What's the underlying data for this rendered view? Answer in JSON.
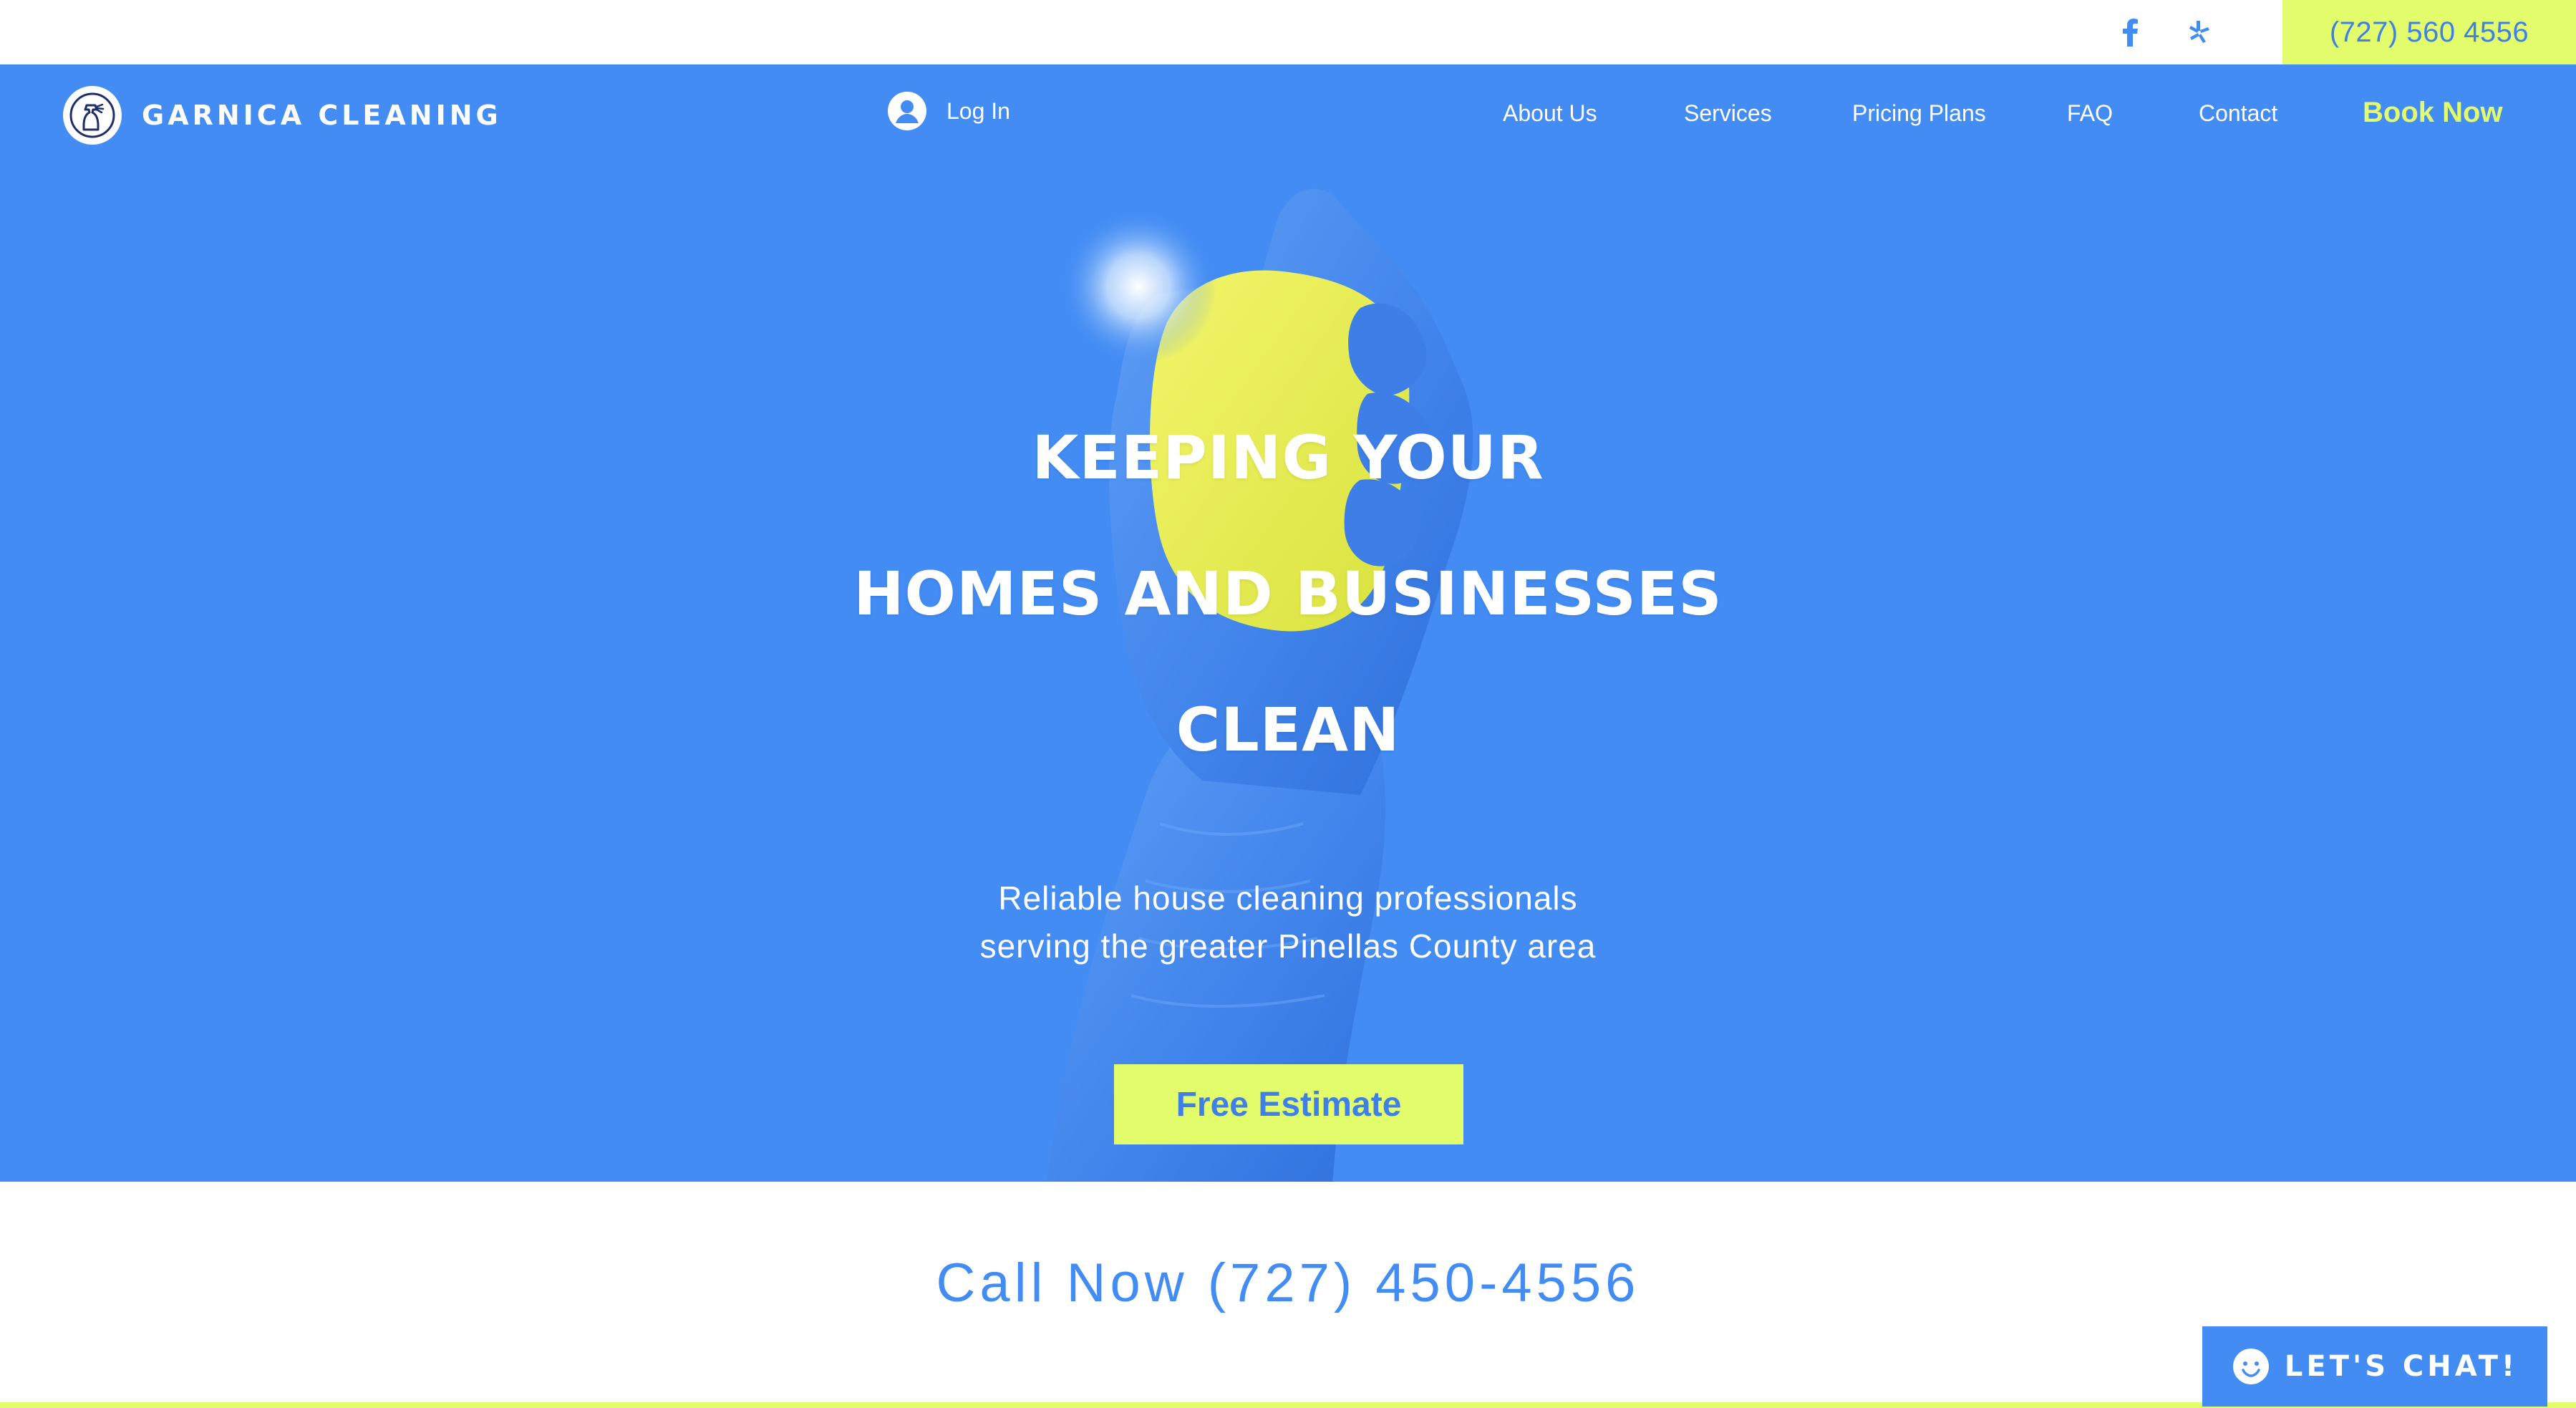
{
  "topbar": {
    "phone": "(727) 560 4556",
    "social": [
      {
        "icon": "facebook-icon"
      },
      {
        "icon": "yelp-icon"
      }
    ]
  },
  "header": {
    "brand": "GARNICA CLEANING",
    "login_label": "Log In",
    "nav": [
      {
        "label": "About Us"
      },
      {
        "label": "Services"
      },
      {
        "label": "Pricing Plans"
      },
      {
        "label": "FAQ"
      },
      {
        "label": "Contact"
      }
    ],
    "book_label": "Book Now"
  },
  "hero": {
    "headline_lines": [
      "KEEPING YOUR",
      "HOMES AND BUSINESSES",
      "CLEAN"
    ],
    "subtitle_lines": [
      "Reliable house cleaning professionals",
      "serving the greater Pinellas County area"
    ],
    "cta_label": "Free Estimate"
  },
  "call_section": {
    "text": "Call Now  (727) 450-4556"
  },
  "chat": {
    "label": "LET'S CHAT!"
  },
  "colors": {
    "brand_blue": "#428cf4",
    "accent_lime": "#e2fc6c",
    "white": "#ffffff",
    "logo_navy": "#1f2d6b"
  }
}
